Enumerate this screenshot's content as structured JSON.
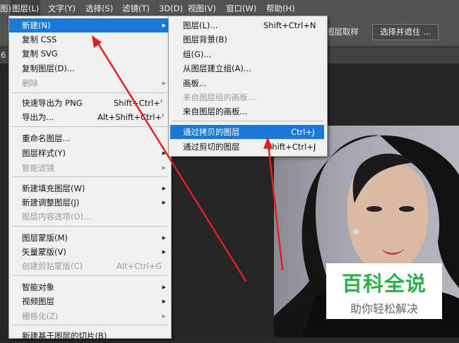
{
  "menubar": {
    "items": [
      "图)",
      "图层(L)",
      "文字(Y)",
      "选择(S)",
      "滤镜(T)",
      "3D(D)",
      "视图(V)",
      "窗口(W)",
      "帮助(H)"
    ]
  },
  "options_bar": {
    "left_fragment": "图层取样",
    "button": "选择并遮住 ..."
  },
  "tab_fragment": "6",
  "layer_menu": [
    {
      "label": "新建(N)",
      "shortcut": "",
      "submenu": true,
      "state": "highlighted"
    },
    {
      "label": "复制 CSS",
      "shortcut": "",
      "submenu": false,
      "state": "normal"
    },
    {
      "label": "复制 SVG",
      "shortcut": "",
      "submenu": false,
      "state": "normal"
    },
    {
      "label": "复制图层(D)...",
      "shortcut": "",
      "submenu": false,
      "state": "normal"
    },
    {
      "label": "删除",
      "shortcut": "",
      "submenu": true,
      "state": "disabled"
    },
    {
      "label": "快速导出为 PNG",
      "shortcut": "Shift+Ctrl+'",
      "submenu": false,
      "state": "normal"
    },
    {
      "label": "导出为...",
      "shortcut": "Alt+Shift+Ctrl+'",
      "submenu": false,
      "state": "normal"
    },
    {
      "label": "重命名图层...",
      "shortcut": "",
      "submenu": false,
      "state": "normal"
    },
    {
      "label": "图层样式(Y)",
      "shortcut": "",
      "submenu": true,
      "state": "normal"
    },
    {
      "label": "智能滤镜",
      "shortcut": "",
      "submenu": true,
      "state": "disabled"
    },
    {
      "label": "新建填充图层(W)",
      "shortcut": "",
      "submenu": true,
      "state": "normal"
    },
    {
      "label": "新建调整图层(J)",
      "shortcut": "",
      "submenu": true,
      "state": "normal"
    },
    {
      "label": "图层内容选项(O)...",
      "shortcut": "",
      "submenu": false,
      "state": "disabled"
    },
    {
      "label": "图层蒙版(M)",
      "shortcut": "",
      "submenu": true,
      "state": "normal"
    },
    {
      "label": "矢量蒙版(V)",
      "shortcut": "",
      "submenu": true,
      "state": "normal"
    },
    {
      "label": "创建剪贴蒙版(C)",
      "shortcut": "Alt+Ctrl+G",
      "submenu": false,
      "state": "disabled"
    },
    {
      "label": "智能对象",
      "shortcut": "",
      "submenu": true,
      "state": "normal"
    },
    {
      "label": "视频图层",
      "shortcut": "",
      "submenu": true,
      "state": "normal"
    },
    {
      "label": "栅格化(Z)",
      "shortcut": "",
      "submenu": true,
      "state": "disabled"
    },
    {
      "label": "新建基于图层的切片(B)",
      "shortcut": "",
      "submenu": false,
      "state": "normal"
    }
  ],
  "new_submenu": [
    {
      "label": "图层(L)...",
      "shortcut": "Shift+Ctrl+N",
      "state": "normal"
    },
    {
      "label": "图层背景(B)",
      "shortcut": "",
      "state": "normal"
    },
    {
      "label": "组(G)...",
      "shortcut": "",
      "state": "normal"
    },
    {
      "label": "从图层建立组(A)...",
      "shortcut": "",
      "state": "normal"
    },
    {
      "label": "画板...",
      "shortcut": "",
      "state": "normal"
    },
    {
      "label": "来自图层组的画板...",
      "shortcut": "",
      "state": "disabled"
    },
    {
      "label": "来自图层的画板...",
      "shortcut": "",
      "state": "normal"
    },
    {
      "label": "通过拷贝的图层",
      "shortcut": "Ctrl+J",
      "state": "highlighted"
    },
    {
      "label": "通过剪切的图层",
      "shortcut": "Shift+Ctrl+J",
      "state": "normal"
    }
  ],
  "watermark": {
    "title": "百科全说",
    "subtitle": "助你轻松解决"
  },
  "colors": {
    "accent": "#1a78d6",
    "arrow": "#e02020",
    "watermark_green": "#2bb14a"
  }
}
